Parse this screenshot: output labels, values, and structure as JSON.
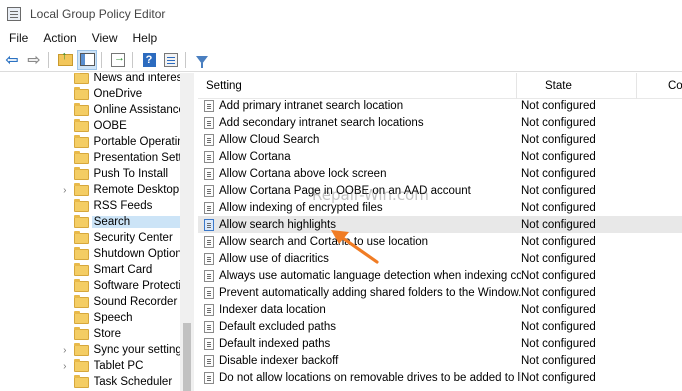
{
  "window": {
    "title": "Local Group Policy Editor"
  },
  "menu": [
    "File",
    "Action",
    "View",
    "Help"
  ],
  "tree": {
    "items": [
      {
        "label": "News and interests",
        "expandable": false
      },
      {
        "label": "OneDrive",
        "expandable": false
      },
      {
        "label": "Online Assistance",
        "expandable": false
      },
      {
        "label": "OOBE",
        "expandable": false
      },
      {
        "label": "Portable Operating",
        "expandable": false
      },
      {
        "label": "Presentation Settin",
        "expandable": false
      },
      {
        "label": "Push To Install",
        "expandable": false
      },
      {
        "label": "Remote Desktop S",
        "expandable": true
      },
      {
        "label": "RSS Feeds",
        "expandable": false
      },
      {
        "label": "Search",
        "expandable": false,
        "selected": true
      },
      {
        "label": "Security Center",
        "expandable": false
      },
      {
        "label": "Shutdown Options",
        "expandable": false
      },
      {
        "label": "Smart Card",
        "expandable": false
      },
      {
        "label": "Software Protectio",
        "expandable": false
      },
      {
        "label": "Sound Recorder",
        "expandable": false
      },
      {
        "label": "Speech",
        "expandable": false
      },
      {
        "label": "Store",
        "expandable": false
      },
      {
        "label": "Sync your settings",
        "expandable": true
      },
      {
        "label": "Tablet PC",
        "expandable": true
      },
      {
        "label": "Task Scheduler",
        "expandable": false
      }
    ],
    "expander_glyph": "›"
  },
  "list": {
    "columns": {
      "setting": "Setting",
      "state": "State",
      "comment": "Co"
    },
    "rows": [
      {
        "setting": "Add primary intranet search location",
        "state": "Not configured"
      },
      {
        "setting": "Add secondary intranet search locations",
        "state": "Not configured"
      },
      {
        "setting": "Allow Cloud Search",
        "state": "Not configured"
      },
      {
        "setting": "Allow Cortana",
        "state": "Not configured"
      },
      {
        "setting": "Allow Cortana above lock screen",
        "state": "Not configured"
      },
      {
        "setting": "Allow Cortana Page in OOBE on an AAD account",
        "state": "Not configured"
      },
      {
        "setting": "Allow indexing of encrypted files",
        "state": "Not configured"
      },
      {
        "setting": "Allow search highlights",
        "state": "Not configured",
        "selected": true
      },
      {
        "setting": "Allow search and Cortana to use location",
        "state": "Not configured"
      },
      {
        "setting": "Allow use of diacritics",
        "state": "Not configured"
      },
      {
        "setting": "Always use automatic language detection when indexing co...",
        "state": "Not configured"
      },
      {
        "setting": "Prevent automatically adding shared folders to the Window...",
        "state": "Not configured"
      },
      {
        "setting": "Indexer data location",
        "state": "Not configured"
      },
      {
        "setting": "Default excluded paths",
        "state": "Not configured"
      },
      {
        "setting": "Default indexed paths",
        "state": "Not configured"
      },
      {
        "setting": "Disable indexer backoff",
        "state": "Not configured"
      },
      {
        "setting": "Do not allow locations on removable drives to be added to li...",
        "state": "Not configured"
      }
    ]
  },
  "watermark": "Repair-Win.com",
  "colors": {
    "annotation_arrow": "#f07c24",
    "selection": "#cce4f7",
    "row_highlight": "#e8e8e8"
  }
}
